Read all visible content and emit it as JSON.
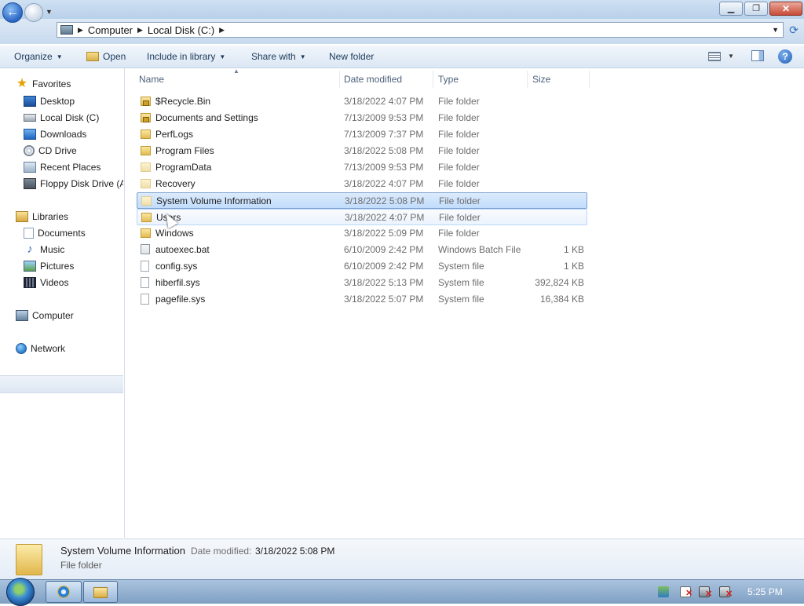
{
  "nav": {
    "back_glyph": "←",
    "refresh_glyph": "⟳"
  },
  "address": {
    "crumbs": [
      "Computer",
      "Local Disk (C:)"
    ]
  },
  "toolbar": {
    "organize": "Organize",
    "open": "Open",
    "include_in_library": "Include in library",
    "share_with": "Share with",
    "new_folder": "New folder",
    "help_glyph": "?"
  },
  "sidebar": {
    "favorites_label": "Favorites",
    "favorites": [
      {
        "label": "Desktop",
        "icon": "desktop-icon"
      },
      {
        "label": "Local Disk (C)",
        "icon": "drive-icon"
      },
      {
        "label": "Downloads",
        "icon": "downloads-icon"
      },
      {
        "label": "CD Drive",
        "icon": "cd-drive-icon"
      },
      {
        "label": "Recent Places",
        "icon": "recent-places-icon"
      },
      {
        "label": "Floppy Disk Drive (A",
        "icon": "floppy-icon"
      }
    ],
    "libraries_label": "Libraries",
    "libraries": [
      {
        "label": "Documents",
        "icon": "documents-icon"
      },
      {
        "label": "Music",
        "icon": "music-icon"
      },
      {
        "label": "Pictures",
        "icon": "pictures-icon"
      },
      {
        "label": "Videos",
        "icon": "videos-icon"
      }
    ],
    "computer_label": "Computer",
    "network_label": "Network"
  },
  "columns": {
    "name": "Name",
    "date_modified": "Date modified",
    "type": "Type",
    "size": "Size"
  },
  "files": [
    {
      "name": "$Recycle.Bin",
      "date": "3/18/2022 4:07 PM",
      "type": "File folder",
      "size": "",
      "icon": "locked-folder-icon"
    },
    {
      "name": "Documents and Settings",
      "date": "7/13/2009 9:53 PM",
      "type": "File folder",
      "size": "",
      "icon": "locked-folder-icon"
    },
    {
      "name": "PerfLogs",
      "date": "7/13/2009 7:37 PM",
      "type": "File folder",
      "size": "",
      "icon": "folder-icon"
    },
    {
      "name": "Program Files",
      "date": "3/18/2022 5:08 PM",
      "type": "File folder",
      "size": "",
      "icon": "folder-icon"
    },
    {
      "name": "ProgramData",
      "date": "7/13/2009 9:53 PM",
      "type": "File folder",
      "size": "",
      "icon": "hidden-folder-icon"
    },
    {
      "name": "Recovery",
      "date": "3/18/2022 4:07 PM",
      "type": "File folder",
      "size": "",
      "icon": "hidden-folder-icon"
    },
    {
      "name": "System Volume Information",
      "date": "3/18/2022 5:08 PM",
      "type": "File folder",
      "size": "",
      "icon": "hidden-folder-icon"
    },
    {
      "name": "Users",
      "date": "3/18/2022 4:07 PM",
      "type": "File folder",
      "size": "",
      "icon": "folder-icon"
    },
    {
      "name": "Windows",
      "date": "3/18/2022 5:09 PM",
      "type": "File folder",
      "size": "",
      "icon": "folder-icon"
    },
    {
      "name": "autoexec.bat",
      "date": "6/10/2009 2:42 PM",
      "type": "Windows Batch File",
      "size": "1 KB",
      "icon": "batch-file-icon"
    },
    {
      "name": "config.sys",
      "date": "6/10/2009 2:42 PM",
      "type": "System file",
      "size": "1 KB",
      "icon": "system-file-icon"
    },
    {
      "name": "hiberfil.sys",
      "date": "3/18/2022 5:13 PM",
      "type": "System file",
      "size": "392,824 KB",
      "icon": "system-file-icon"
    },
    {
      "name": "pagefile.sys",
      "date": "3/18/2022 5:07 PM",
      "type": "System file",
      "size": "16,384 KB",
      "icon": "system-file-icon"
    }
  ],
  "selection": {
    "selected_index": 6,
    "hover_index": 7
  },
  "details": {
    "name": "System Volume Information",
    "modified_label": "Date modified:",
    "modified_value": "3/18/2022 5:08 PM",
    "type": "File folder"
  },
  "taskbar": {
    "clock": "5:25 PM"
  },
  "colors": {
    "accent": "#3d8ed6",
    "selection_fill": "#c1dcfc",
    "selection_border": "#7da2ce"
  }
}
